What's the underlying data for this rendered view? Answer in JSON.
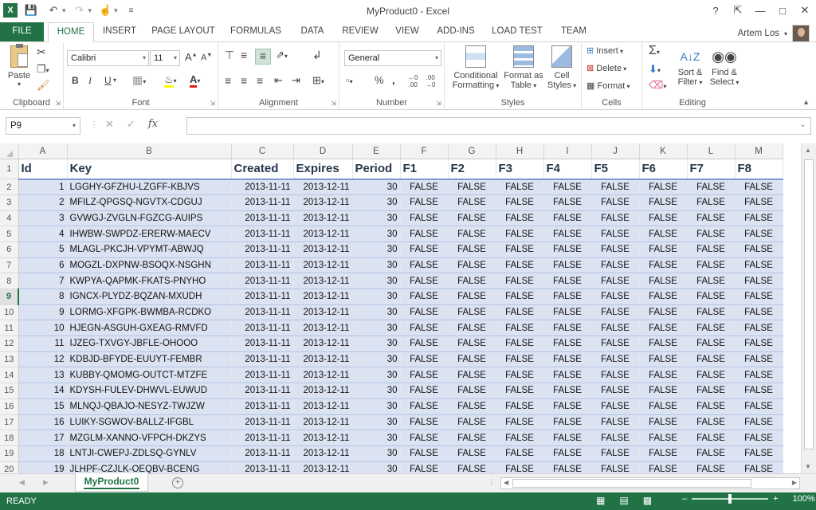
{
  "window": {
    "title": "MyProduct0 - Excel",
    "help": "?",
    "user": "Artem Los"
  },
  "ribbon_tabs": [
    "FILE",
    "HOME",
    "INSERT",
    "PAGE LAYOUT",
    "FORMULAS",
    "DATA",
    "REVIEW",
    "VIEW",
    "ADD-INS",
    "LOAD TEST",
    "TEAM"
  ],
  "active_tab": "HOME",
  "groups": {
    "clipboard": {
      "label": "Clipboard",
      "paste": "Paste"
    },
    "font": {
      "label": "Font",
      "name": "Calibri",
      "size": "11",
      "bold": "B",
      "italic": "I",
      "underline": "U",
      "grow": "A",
      "shrink": "A"
    },
    "alignment": {
      "label": "Alignment"
    },
    "number": {
      "label": "Number",
      "format": "General",
      "percent": "%",
      "comma": ","
    },
    "styles": {
      "label": "Styles",
      "conditional_1": "Conditional",
      "conditional_2": "Formatting",
      "table_1": "Format as",
      "table_2": "Table",
      "cell_1": "Cell",
      "cell_2": "Styles"
    },
    "cells": {
      "label": "Cells",
      "insert": "Insert",
      "delete": "Delete",
      "format": "Format"
    },
    "editing": {
      "label": "Editing",
      "sort_1": "Sort &",
      "sort_2": "Filter",
      "find_1": "Find &",
      "find_2": "Select"
    }
  },
  "formula_bar": {
    "name_box": "P9",
    "fx": "fx",
    "content": ""
  },
  "columns": [
    "A",
    "B",
    "C",
    "D",
    "E",
    "F",
    "G",
    "H",
    "I",
    "J",
    "K",
    "L",
    "M"
  ],
  "header_row": [
    "Id",
    "Key",
    "Created",
    "Expires",
    "Period",
    "F1",
    "F2",
    "F3",
    "F4",
    "F5",
    "F6",
    "F7",
    "F8"
  ],
  "rows": [
    {
      "n": "2",
      "id": "1",
      "key": "LGGHY-GFZHU-LZGFF-KBJVS"
    },
    {
      "n": "3",
      "id": "2",
      "key": "MFILZ-QPGSQ-NGVTX-CDGUJ"
    },
    {
      "n": "4",
      "id": "3",
      "key": "GVWGJ-ZVGLN-FGZCG-AUIPS"
    },
    {
      "n": "5",
      "id": "4",
      "key": "IHWBW-SWPDZ-ERERW-MAECV"
    },
    {
      "n": "6",
      "id": "5",
      "key": "MLAGL-PKCJH-VPYMT-ABWJQ"
    },
    {
      "n": "7",
      "id": "6",
      "key": "MOGZL-DXPNW-BSOQX-NSGHN"
    },
    {
      "n": "8",
      "id": "7",
      "key": "KWPYA-QAPMK-FKATS-PNYHO"
    },
    {
      "n": "9",
      "id": "8",
      "key": "IGNCX-PLYDZ-BQZAN-MXUDH"
    },
    {
      "n": "10",
      "id": "9",
      "key": "LORMG-XFGPK-BWMBA-RCDKO"
    },
    {
      "n": "11",
      "id": "10",
      "key": "HJEGN-ASGUH-GXEAG-RMVFD"
    },
    {
      "n": "12",
      "id": "11",
      "key": "IJZEG-TXVGY-JBFLE-OHOOO"
    },
    {
      "n": "13",
      "id": "12",
      "key": "KDBJD-BFYDE-EUUYT-FEMBR"
    },
    {
      "n": "14",
      "id": "13",
      "key": "KUBBY-QMOMG-OUTCT-MTZFE"
    },
    {
      "n": "15",
      "id": "14",
      "key": "KDYSH-FULEV-DHWVL-EUWUD"
    },
    {
      "n": "16",
      "id": "15",
      "key": "MLNQJ-QBAJO-NESYZ-TWJZW"
    },
    {
      "n": "17",
      "id": "16",
      "key": "LUIKY-SGWOV-BALLZ-IFGBL"
    },
    {
      "n": "18",
      "id": "17",
      "key": "MZGLM-XANNO-VFPCH-DKZYS"
    },
    {
      "n": "19",
      "id": "18",
      "key": "LNTJI-CWEPJ-ZDLSQ-GYNLV"
    },
    {
      "n": "20",
      "id": "19",
      "key": "JLHPF-CZJLK-OEQBV-BCENG"
    }
  ],
  "row_defaults": {
    "created": "2013-11-11",
    "expires": "2013-12-11",
    "period": "30",
    "flag": "FALSE"
  },
  "selected_row": "9",
  "sheet_tab": "MyProduct0",
  "status": {
    "ready": "READY",
    "zoom": "100%"
  }
}
